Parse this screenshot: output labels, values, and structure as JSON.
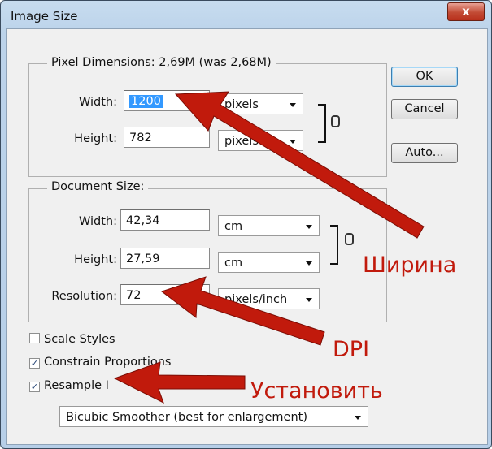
{
  "window": {
    "title": "Image Size",
    "close_symbol": "x"
  },
  "pixel_dimensions": {
    "legend": "Pixel Dimensions:  2,69M (was 2,68M)",
    "width_label": "Width:",
    "width_value": "1200",
    "width_unit": "pixels",
    "height_label": "Height:",
    "height_value": "782",
    "height_unit": "pixels"
  },
  "document_size": {
    "legend": "Document Size:",
    "width_label": "Width:",
    "width_value": "42,34",
    "width_unit": "cm",
    "height_label": "Height:",
    "height_value": "27,59",
    "height_unit": "cm",
    "resolution_label": "Resolution:",
    "resolution_value": "72",
    "resolution_unit": "pixels/inch"
  },
  "buttons": {
    "ok": "OK",
    "cancel": "Cancel",
    "auto": "Auto..."
  },
  "options": {
    "scale_styles": {
      "label": "Scale Styles",
      "checked": false
    },
    "constrain_proportions": {
      "label": "Constrain Proportions",
      "checked": true
    },
    "resample_image": {
      "label": "Resample I",
      "checked": true
    },
    "interpolation": "Bicubic Smoother (best for enlargement)"
  },
  "annotations": {
    "width": "Ширина",
    "dpi": "DPI",
    "resample": "Установить"
  },
  "colors": {
    "annotation_red": "#c11a0c",
    "selection_blue": "#3399ff"
  }
}
